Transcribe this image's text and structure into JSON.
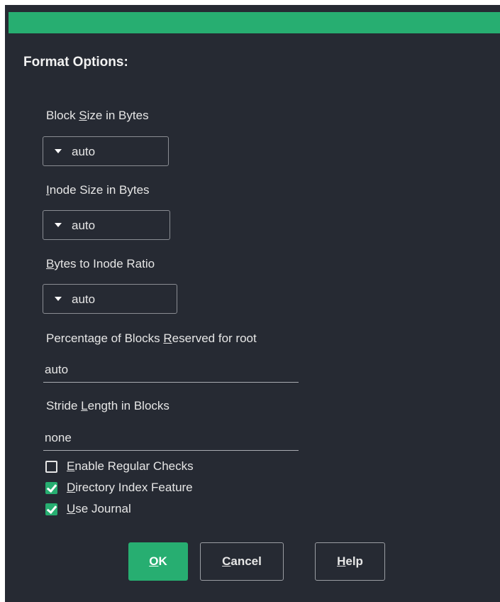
{
  "colors": {
    "background": "#262a33",
    "accent": "#27ae71",
    "text": "#e6e6e6"
  },
  "section_title": "Format Options:",
  "block_size": {
    "label_before": "Block ",
    "label_mnemonic": "S",
    "label_after": "ize in Bytes",
    "value": "auto"
  },
  "inode_size": {
    "label_before": "",
    "label_mnemonic": "I",
    "label_after": "node Size in Bytes",
    "value": "auto"
  },
  "inode_ratio": {
    "label_before": "",
    "label_mnemonic": "B",
    "label_after": "ytes to Inode Ratio",
    "value": "auto"
  },
  "reserved": {
    "label_before": "Percentage of Blocks ",
    "label_mnemonic": "R",
    "label_after": "eserved for root",
    "value": "auto"
  },
  "stride": {
    "label_before": "Stride ",
    "label_mnemonic": "L",
    "label_after": "ength in Blocks",
    "value": "none"
  },
  "checkboxes": [
    {
      "mnemonic": "E",
      "rest": "nable Regular Checks",
      "checked": false
    },
    {
      "mnemonic": "D",
      "rest": "irectory Index Feature",
      "checked": true
    },
    {
      "mnemonic": "U",
      "rest": "se Journal",
      "checked": true
    }
  ],
  "buttons": {
    "ok": {
      "mnemonic": "O",
      "rest": "K"
    },
    "cancel": {
      "mnemonic": "C",
      "rest": "ancel"
    },
    "help": {
      "mnemonic": "H",
      "rest": "elp"
    }
  },
  "icons": {
    "dropdown": "caret-down-icon",
    "check": "checkmark-icon"
  }
}
